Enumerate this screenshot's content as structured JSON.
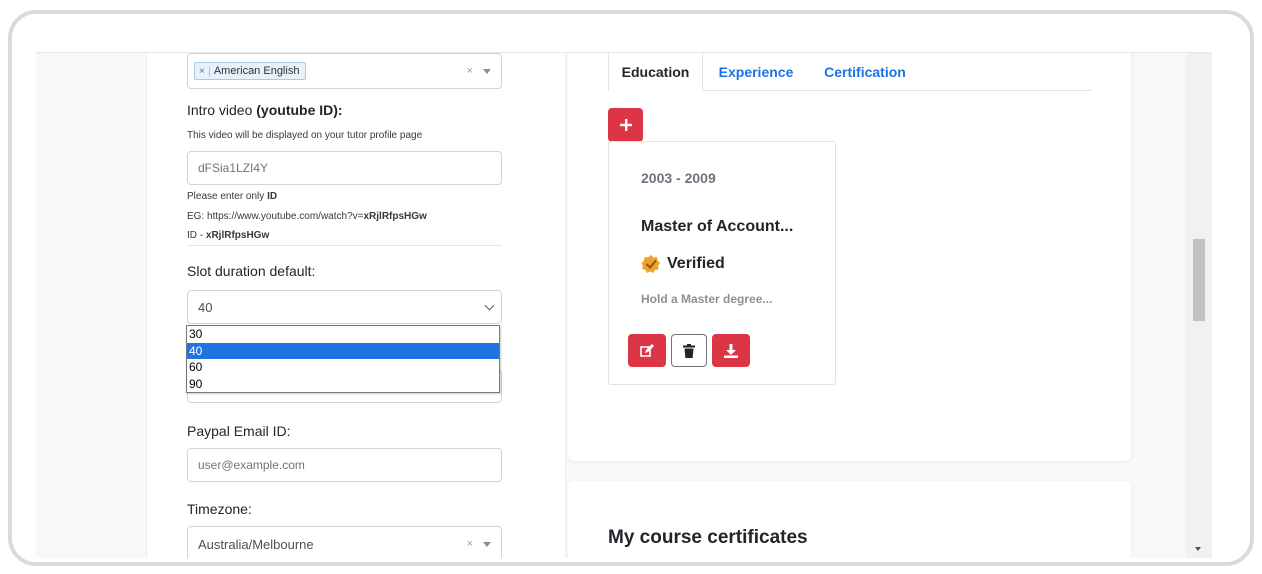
{
  "form": {
    "language_tag": "American English",
    "intro_label_plain": "Intro video ",
    "intro_label_bold": "(youtube ID):",
    "intro_help": "This video will be displayed on your tutor profile page",
    "intro_value": "dFSia1LZI4Y",
    "enter_only_prefix": "Please enter only ",
    "enter_only_bold": "ID",
    "example_prefix": "EG: https://www.youtube.com/watch?v=",
    "example_bold": "xRjlRfpsHGw",
    "id_prefix": "ID - ",
    "id_bold": "xRjlRfpsHGw",
    "slot_label": "Slot duration default:",
    "slot_value": "40",
    "slot_options": [
      "30",
      "40",
      "60",
      "90"
    ],
    "paypal_label": "Paypal Email ID:",
    "paypal_placeholder": "user@example.com",
    "timezone_label": "Timezone:",
    "timezone_value": "Australia/Melbourne",
    "clear_symbol": "×",
    "tag_remove_symbol": "×"
  },
  "tabs": {
    "education": "Education",
    "experience": "Experience",
    "certification": "Certification"
  },
  "education_card": {
    "years": "2003 - 2009",
    "title": "Master of Account...",
    "verified": "Verified",
    "description": "Hold a Master degree..."
  },
  "certificates": {
    "title": "My course certificates"
  },
  "colors": {
    "accent_red": "#dc3545",
    "link_blue": "#1a73e8",
    "selected_option": "#1e74e0",
    "verified_badge": "#f0a030"
  }
}
